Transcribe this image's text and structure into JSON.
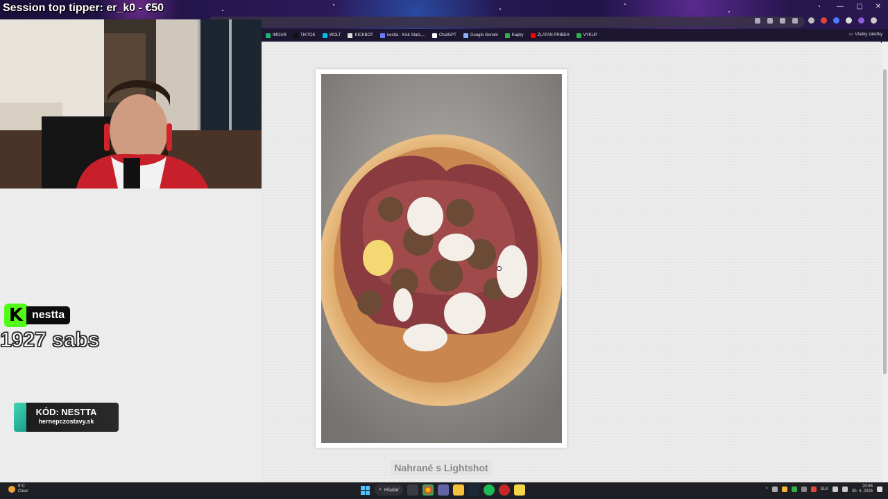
{
  "overlay": {
    "session_title": "Session top tipper: er_k0 - €50",
    "kick_logo_letter": "K",
    "kick_name": "nestta",
    "subs_text": "1927 sabs",
    "promo_code": "KÓD: NESTTA",
    "promo_site": "hernepczostavy.sk"
  },
  "browser": {
    "bookmarks": [
      {
        "label": "IMGUR",
        "color": "#1bb76e"
      },
      {
        "label": "TIKTOK",
        "color": "#111111"
      },
      {
        "label": "WOLT",
        "color": "#00c2e8"
      },
      {
        "label": "KICKBOT",
        "color": "#dddddd"
      },
      {
        "label": "nestta - Kick Stats,...",
        "color": "#6b7cff"
      },
      {
        "label": "ChatGPT",
        "color": "#ffffff"
      },
      {
        "label": "Google Gemini",
        "color": "#8ab4f8"
      },
      {
        "label": "Kapky",
        "color": "#2fb24a"
      },
      {
        "label": "ZLATAN PRIBEH",
        "color": "#ff0000"
      },
      {
        "label": "VYKUP",
        "color": "#2fb24a"
      }
    ],
    "all_bookmarks": "Všetky záložky"
  },
  "page": {
    "caption": "Nahrané s Lightshot"
  },
  "taskbar": {
    "weather_temp": "9°C",
    "weather_desc": "Clear",
    "search_label": "Hľadať",
    "lang": "SLK",
    "time": "20:55",
    "date": "30. 4. 2026"
  },
  "colors": {
    "kick_green": "#53fc18",
    "promo_accent": "#3fd6b5"
  }
}
